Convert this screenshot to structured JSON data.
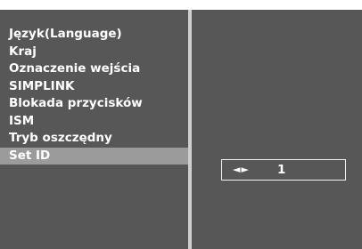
{
  "menu": {
    "items": [
      {
        "label": "Język(Language)",
        "selected": false
      },
      {
        "label": "Kraj",
        "selected": false
      },
      {
        "label": "Oznaczenie wejścia",
        "selected": false
      },
      {
        "label": "SIMPLINK",
        "selected": false
      },
      {
        "label": "Blokada przycisków",
        "selected": false
      },
      {
        "label": "ISM",
        "selected": false
      },
      {
        "label": "Tryb oszczędny",
        "selected": false
      },
      {
        "label": "Set ID",
        "selected": true
      }
    ]
  },
  "set_id": {
    "arrows": "◄►",
    "value": "1"
  },
  "colors": {
    "panel": "#575757",
    "divider": "#cfcfcf",
    "selected": "#9b9b9b",
    "text": "#ffffff"
  }
}
